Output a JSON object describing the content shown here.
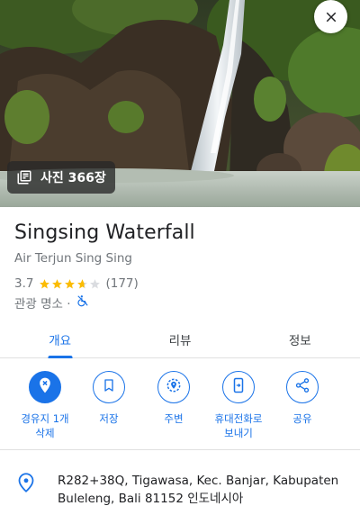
{
  "hero": {
    "photo_count_label": "사진 366장"
  },
  "place": {
    "name": "Singsing Waterfall",
    "local_name": "Air Terjun Sing Sing",
    "rating": "3.7",
    "rating_value": 3.7,
    "review_count": "(177)",
    "category": "관광 명소 ·"
  },
  "tabs": [
    {
      "label": "개요",
      "active": true
    },
    {
      "label": "리뷰",
      "active": false
    },
    {
      "label": "정보",
      "active": false
    }
  ],
  "actions": [
    {
      "label": "경유지 1개 삭제",
      "icon": "place-remove-icon"
    },
    {
      "label": "저장",
      "icon": "bookmark-icon"
    },
    {
      "label": "주변",
      "icon": "nearby-icon"
    },
    {
      "label": "휴대전화로 보내기",
      "icon": "send-to-phone-icon"
    },
    {
      "label": "공유",
      "icon": "share-icon"
    }
  ],
  "address": "R282+38Q, Tigawasa, Kec. Banjar, Kabupaten Buleleng, Bali 81152 인도네시아",
  "colors": {
    "accent": "#1a73e8",
    "star": "#fbbc04",
    "star_empty": "#dadce0",
    "secondary_text": "#70757a"
  }
}
